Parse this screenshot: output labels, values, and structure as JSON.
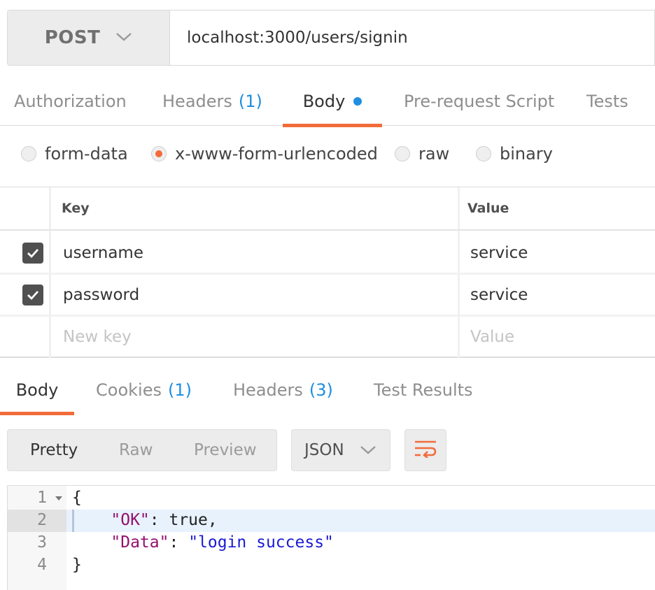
{
  "request": {
    "method": "POST",
    "method_icon": "chevron-down-icon",
    "url": "localhost:3000/users/signin"
  },
  "request_tabs": [
    {
      "label": "Authorization",
      "count": "",
      "active": false
    },
    {
      "label": "Headers",
      "count": "(1)",
      "active": false
    },
    {
      "label": "Body",
      "count": "",
      "active": true,
      "dot": true
    },
    {
      "label": "Pre-request Script",
      "count": "",
      "active": false
    },
    {
      "label": "Tests",
      "count": "",
      "active": false
    }
  ],
  "body_types": [
    {
      "label": "form-data",
      "selected": false
    },
    {
      "label": "x-www-form-urlencoded",
      "selected": true
    },
    {
      "label": "raw",
      "selected": false
    },
    {
      "label": "binary",
      "selected": false
    }
  ],
  "params": {
    "headers": {
      "key": "Key",
      "value": "Value"
    },
    "rows": [
      {
        "checked": true,
        "key": "username",
        "value": "service"
      },
      {
        "checked": true,
        "key": "password",
        "value": "service"
      }
    ],
    "new_row": {
      "key_placeholder": "New key",
      "value_placeholder": "Value"
    }
  },
  "response_tabs": [
    {
      "label": "Body",
      "count": "",
      "active": true
    },
    {
      "label": "Cookies",
      "count": "(1)",
      "active": false
    },
    {
      "label": "Headers",
      "count": "(3)",
      "active": false
    },
    {
      "label": "Test Results",
      "count": "",
      "active": false
    }
  ],
  "response_toolbar": {
    "formats": [
      "Pretty",
      "Raw",
      "Preview"
    ],
    "active_format": "Pretty",
    "language": "JSON",
    "wrap_icon": "wrap-lines-icon"
  },
  "response_body": {
    "line_numbers": [
      "1",
      "2",
      "3",
      "4"
    ],
    "open_brace": "{",
    "close_brace": "}",
    "ok_key": "\"OK\"",
    "ok_sep": ": ",
    "ok_value": "true,",
    "data_key": "\"Data\"",
    "data_sep": ": ",
    "data_value": "\"login success\""
  },
  "colors": {
    "accent": "#f26b3a",
    "count_blue": "#1f8ee0",
    "json_key": "#93116e",
    "json_string": "#1b1bd4"
  }
}
